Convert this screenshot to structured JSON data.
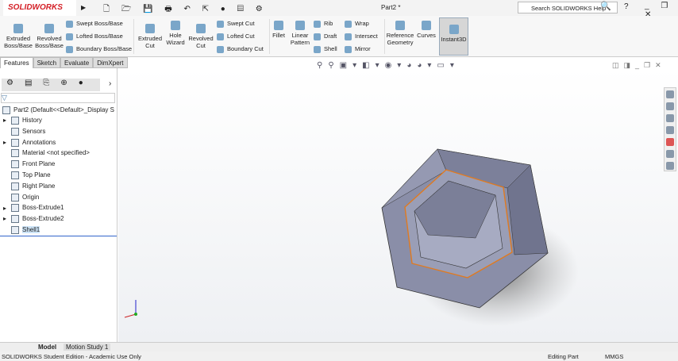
{
  "app": {
    "logo": "SOLIDWORKS",
    "document_title": "Part2 *",
    "search_placeholder": "Search SOLIDWORKS Help",
    "help": "?"
  },
  "ribbon": {
    "large": [
      "Extruded Boss/Base",
      "Revolved Boss/Base",
      "Extruded Cut",
      "Hole Wizard",
      "Revolved Cut",
      "Fillet",
      "Linear Pattern",
      "Reference Geometry",
      "Curves",
      "Instant3D"
    ],
    "small": [
      "Swept Boss/Base",
      "Lofted Boss/Base",
      "Boundary Boss/Base",
      "Swept Cut",
      "Lofted Cut",
      "Boundary Cut",
      "Rib",
      "Draft",
      "Shell",
      "Wrap",
      "Intersect",
      "Mirror"
    ]
  },
  "tabs": [
    "Features",
    "Sketch",
    "Evaluate",
    "DimXpert"
  ],
  "tree": {
    "root": "Part2  (Default<<Default>_Display S",
    "items": [
      "History",
      "Sensors",
      "Annotations",
      "Material <not specified>",
      "Front Plane",
      "Top Plane",
      "Right Plane",
      "Origin",
      "Boss-Extrude1",
      "Boss-Extrude2",
      "Shell1"
    ]
  },
  "bottom_tabs": [
    "Model",
    "Motion Study 1"
  ],
  "status": {
    "left": "SOLIDWORKS Student Edition - Academic Use Only",
    "mode": "Editing Part",
    "units": "MMGS"
  },
  "colors": {
    "accent": "#d42027",
    "model": "#8a8ea8",
    "edge_highlight": "#e07a20",
    "selection": "#cde4f7"
  }
}
